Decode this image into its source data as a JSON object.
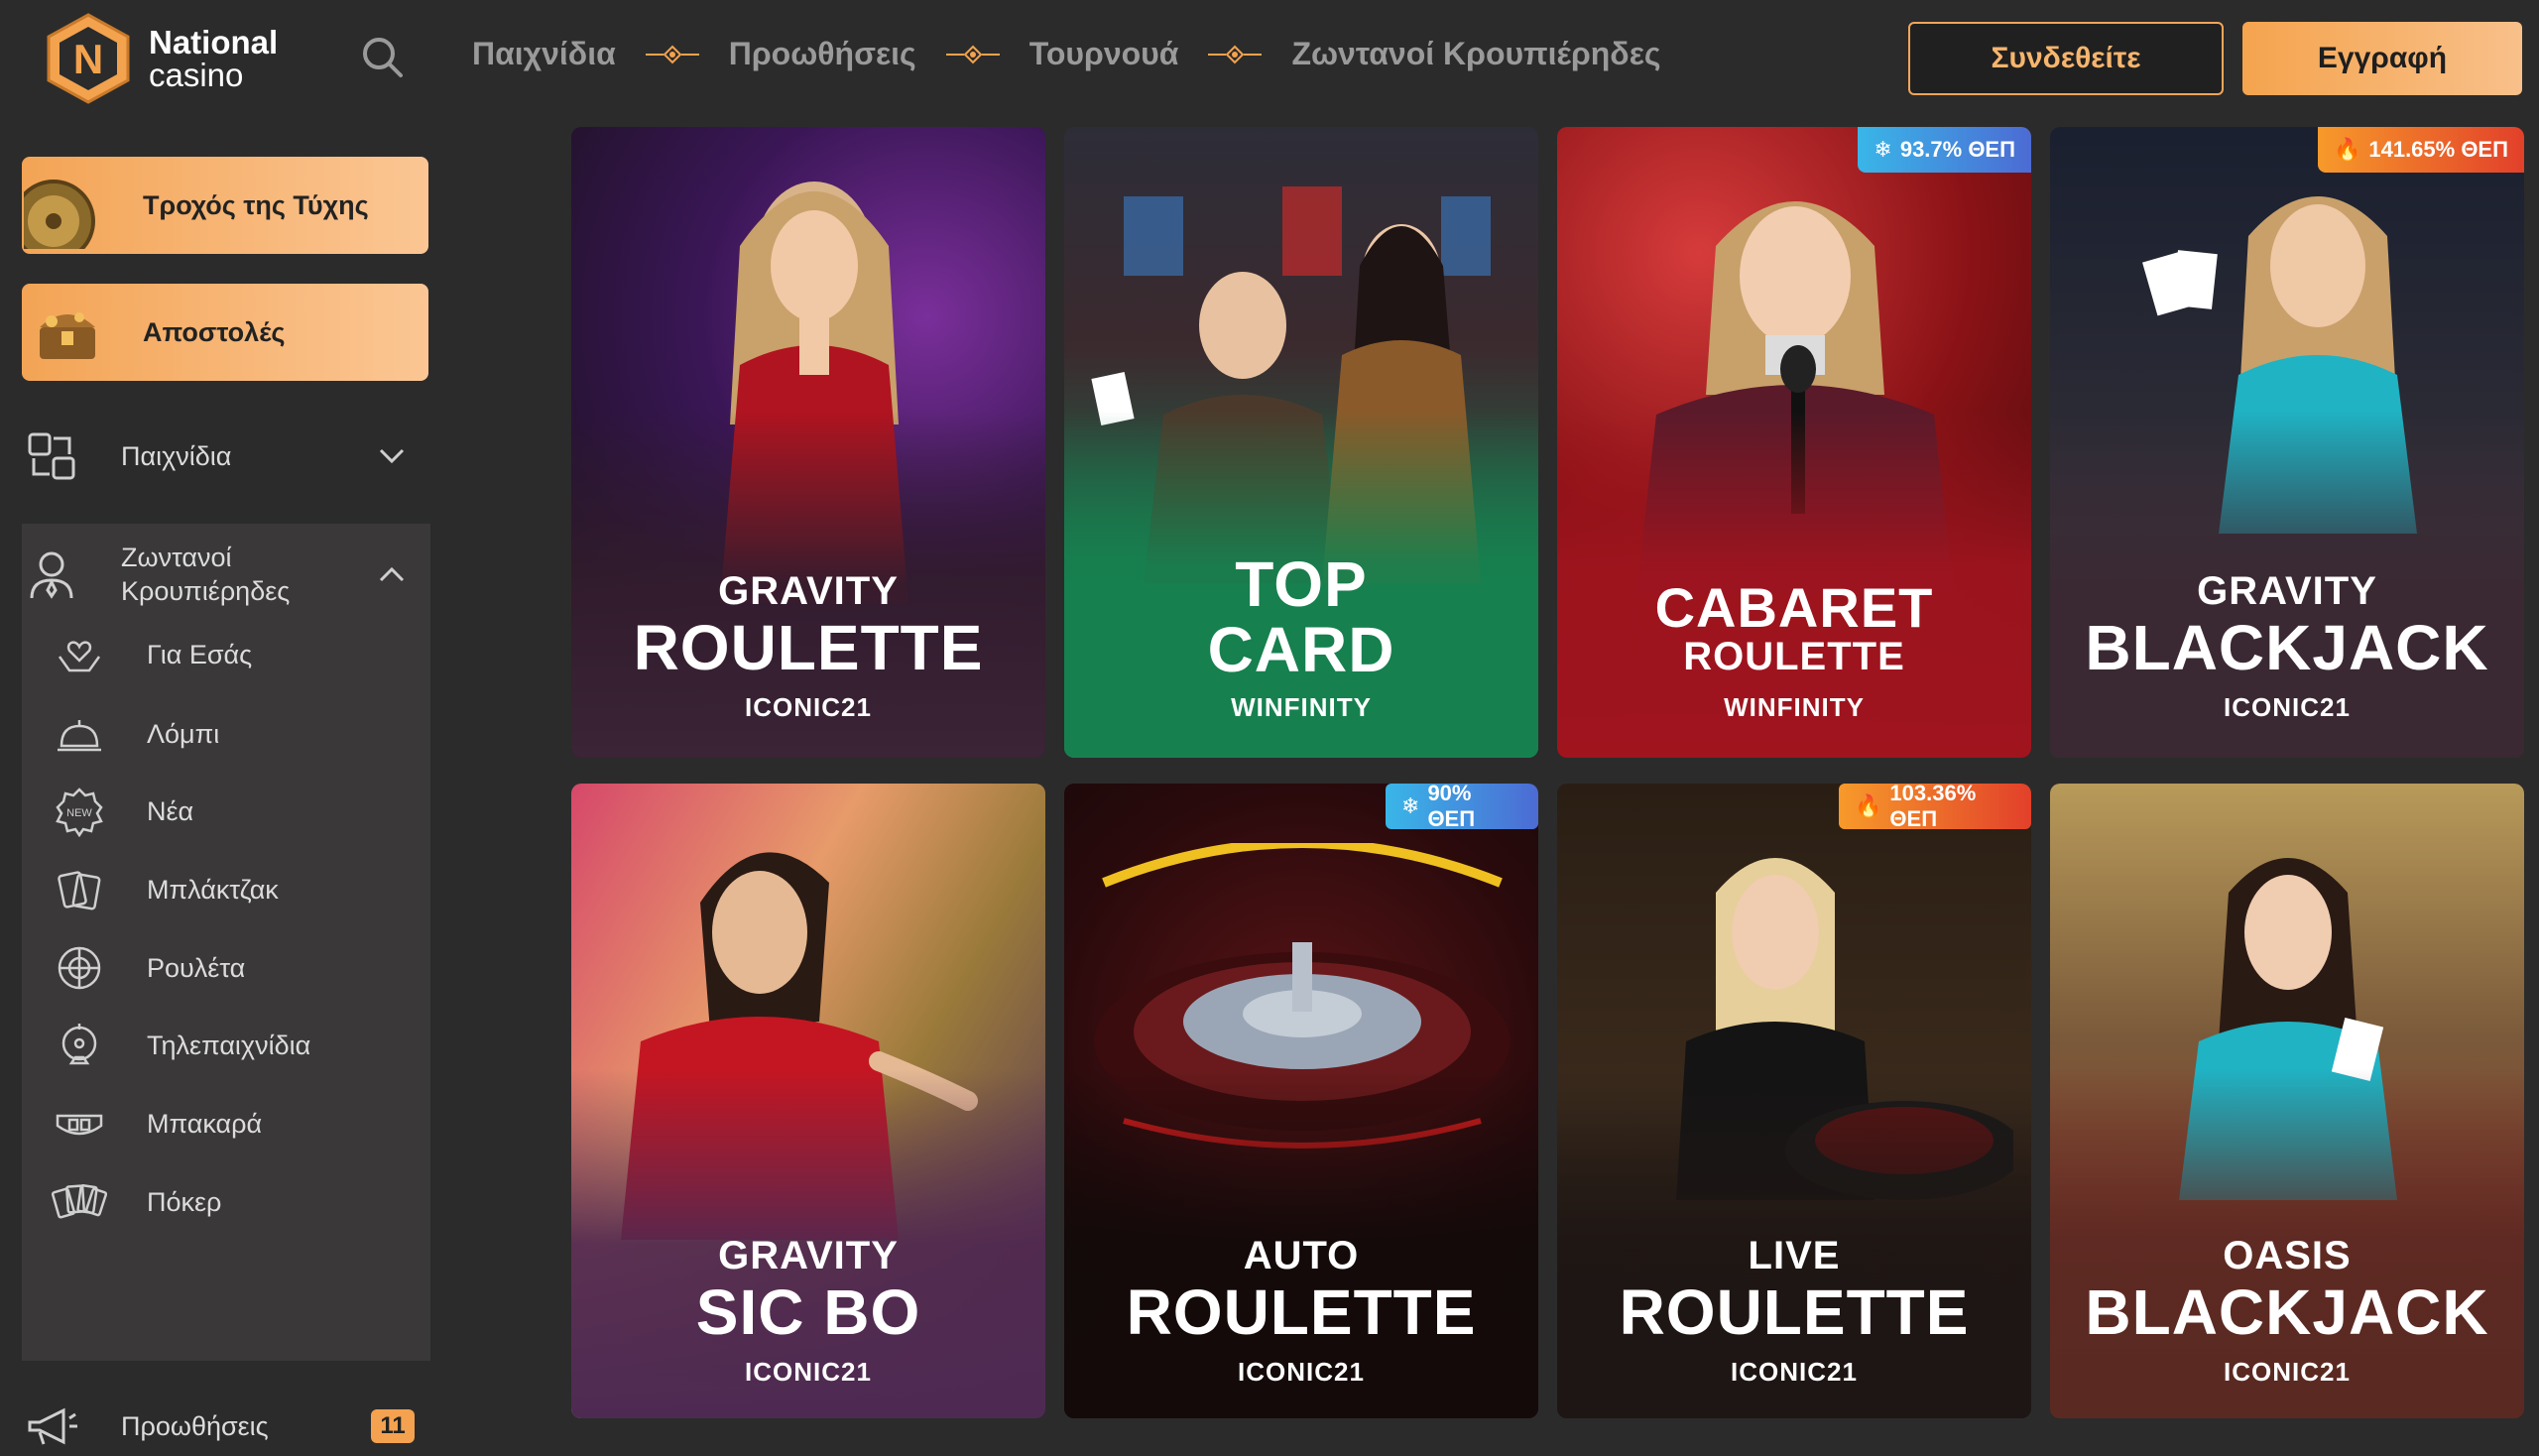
{
  "logo": {
    "letter": "N",
    "line1": "National",
    "line2": "casino"
  },
  "nav": {
    "items": [
      "Παιχνίδια",
      "Προωθήσεις",
      "Τουρνουά",
      "Ζωντανοί Κρουπιέρηδες"
    ]
  },
  "header": {
    "login": "Συνδεθείτε",
    "register": "Εγγραφή"
  },
  "sidebar": {
    "promos": [
      "Τροχός της Τύχης",
      "Αποστολές"
    ],
    "games": "Παιχνίδια",
    "live_line1": "Ζωντανοί",
    "live_line2": "Κρουπιέρηδες",
    "live_sub": [
      "Για Εσάς",
      "Λόμπι",
      "Νέα",
      "Μπλάκτζακ",
      "Ρουλέτα",
      "Τηλεπαιχνίδια",
      "Μπακαρά",
      "Πόκερ"
    ],
    "promotions": "Προωθήσεις",
    "promotions_badge": "11"
  },
  "cards": [
    {
      "line1": "GRAVITY",
      "line2": "ROULETTE",
      "provider": "ICONIC21",
      "rtp": ""
    },
    {
      "line1": "TOP",
      "line2": "CARD",
      "provider": "WINFINITY",
      "rtp": ""
    },
    {
      "line1": "CABARET",
      "line2": "ROULETTE",
      "provider": "WINFINITY",
      "rtp": "93.7% ΘΕΠ"
    },
    {
      "line1": "GRAVITY",
      "line2": "BLACKJACK",
      "provider": "ICONIC21",
      "rtp": "141.65% ΘΕΠ"
    },
    {
      "line1": "GRAVITY",
      "line2": "SIC BO",
      "provider": "ICONIC21",
      "rtp": ""
    },
    {
      "line1": "AUTO",
      "line2": "ROULETTE",
      "provider": "ICONIC21",
      "rtp": "90% ΘΕΠ"
    },
    {
      "line1": "LIVE",
      "line2": "ROULETTE",
      "provider": "ICONIC21",
      "rtp": "103.36% ΘΕΠ"
    },
    {
      "line1": "OASIS",
      "line2": "BLACKJACK",
      "provider": "ICONIC21",
      "rtp": ""
    }
  ],
  "colors": {
    "accent": "#f4a24f",
    "bg": "#2b2b2b",
    "panel": "#3a3839"
  }
}
